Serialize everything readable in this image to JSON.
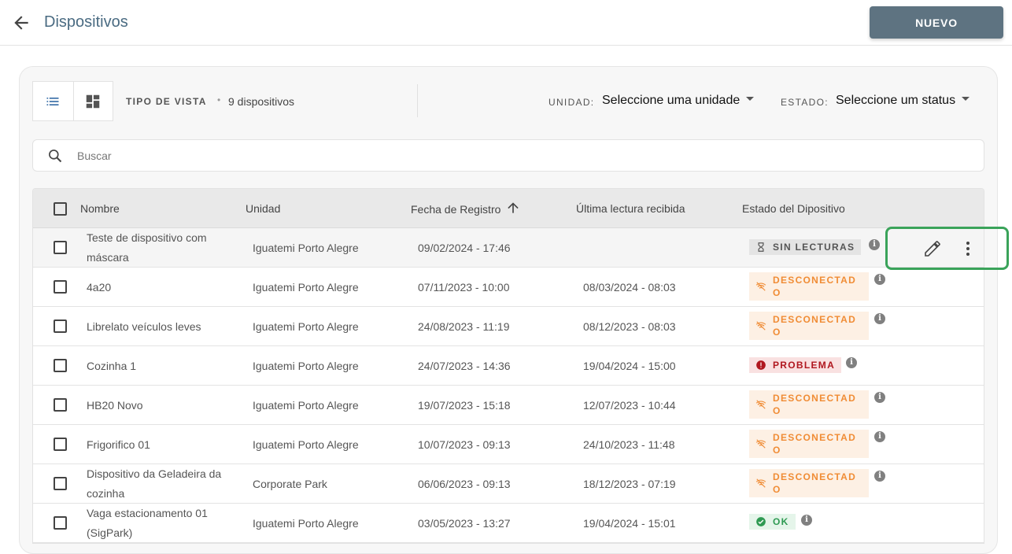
{
  "header": {
    "title": "Dispositivos",
    "new_button": "NUEVO"
  },
  "toolbar": {
    "view_type_label": "TIPO DE VISTA",
    "dot": "•",
    "device_count": "9 dispositivos",
    "unit_label": "UNIDAD:",
    "unit_value": "Seleccione uma unidade",
    "status_label": "ESTADO:",
    "status_value": "Seleccione um status"
  },
  "search": {
    "placeholder": "Buscar"
  },
  "table": {
    "columns": [
      "Nombre",
      "Unidad",
      "Fecha de Registro",
      "Última lectura recibida",
      "Estado del Dipositivo"
    ],
    "rows": [
      {
        "name": "Teste de dispositivo com máscara",
        "unit": "Iguatemi Porto Alegre",
        "registered": "09/02/2024 - 17:46",
        "last_reading": "",
        "status": "SIN LECTURAS",
        "status_kind": "gray"
      },
      {
        "name": "4a20",
        "unit": "Iguatemi Porto Alegre",
        "registered": "07/11/2023 - 10:00",
        "last_reading": "08/03/2024 - 08:03",
        "status": "DESCONECTADO",
        "status_kind": "orange"
      },
      {
        "name": "Librelato veículos leves",
        "unit": "Iguatemi Porto Alegre",
        "registered": "24/08/2023 - 11:19",
        "last_reading": "08/12/2023 - 08:03",
        "status": "DESCONECTADO",
        "status_kind": "orange"
      },
      {
        "name": "Cozinha 1",
        "unit": "Iguatemi Porto Alegre",
        "registered": "24/07/2023 - 14:36",
        "last_reading": "19/04/2024 - 15:00",
        "status": "PROBLEMA",
        "status_kind": "red"
      },
      {
        "name": "HB20 Novo",
        "unit": "Iguatemi Porto Alegre",
        "registered": "19/07/2023 - 15:18",
        "last_reading": "12/07/2023 - 10:44",
        "status": "DESCONECTADO",
        "status_kind": "orange"
      },
      {
        "name": "Frigorifico 01",
        "unit": "Iguatemi Porto Alegre",
        "registered": "10/07/2023 - 09:13",
        "last_reading": "24/10/2023 - 11:48",
        "status": "DESCONECTADO",
        "status_kind": "orange"
      },
      {
        "name": "Dispositivo da Geladeira da cozinha",
        "unit": "Corporate Park",
        "registered": "06/06/2023 - 09:13",
        "last_reading": "18/12/2023 - 07:19",
        "status": "DESCONECTADO",
        "status_kind": "orange"
      },
      {
        "name": "Vaga estacionamento 01 (SigPark)",
        "unit": "Iguatemi Porto Alegre",
        "registered": "03/05/2023 - 13:27",
        "last_reading": "19/04/2024 - 15:01",
        "status": "OK",
        "status_kind": "green"
      }
    ]
  },
  "icons": {
    "back": "arrow-left-icon",
    "list": "list-view-icon",
    "grid": "dashboard-view-icon",
    "search": "search-icon",
    "sort": "arrow-up-icon",
    "edit": "pencil-icon",
    "more": "more-vert-icon",
    "info": "info-icon",
    "hourglass": "hourglass-icon",
    "wifi_off": "wifi-off-icon",
    "error": "error-icon",
    "check": "check-circle-icon"
  },
  "colors": {
    "accent": "#4a6b82",
    "button": "#5e7381",
    "highlight": "#3aa35a"
  }
}
